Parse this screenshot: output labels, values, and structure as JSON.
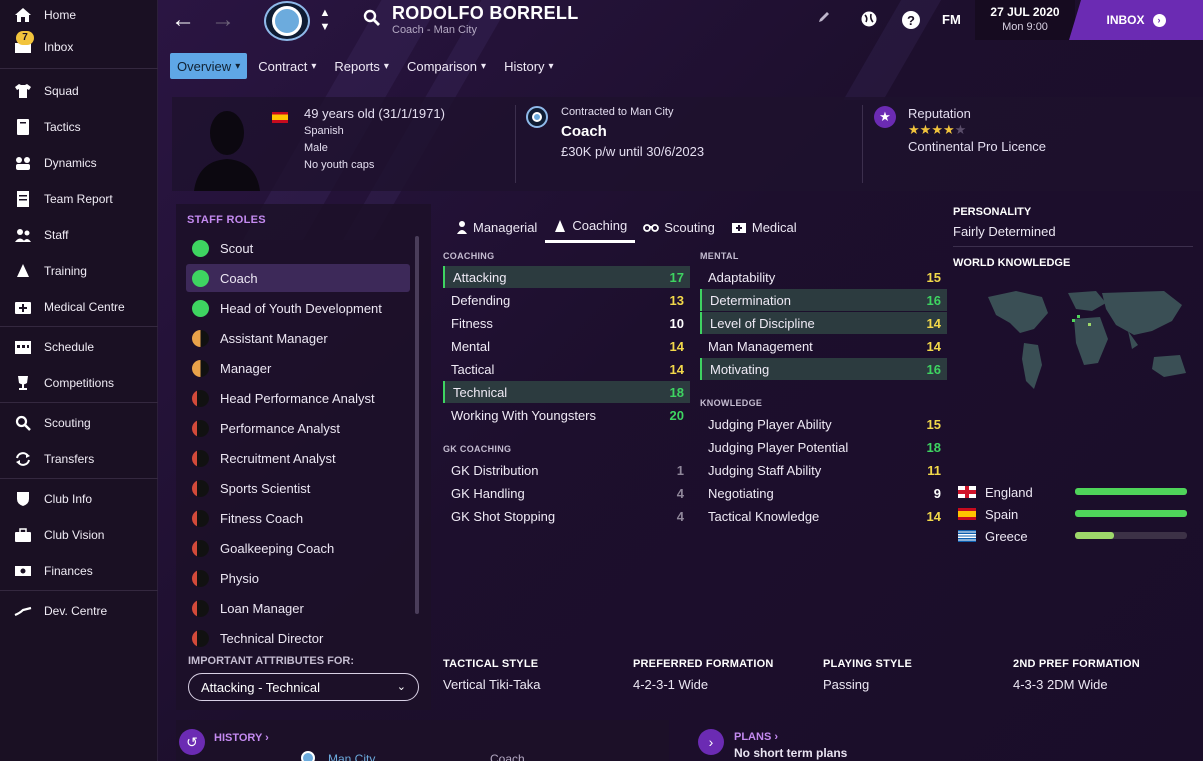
{
  "sidebar": {
    "items": [
      {
        "label": "Home",
        "icon": "home-icon"
      },
      {
        "label": "Inbox",
        "icon": "inbox-icon",
        "badge": "7"
      },
      {
        "label": "Squad",
        "icon": "shirt-icon"
      },
      {
        "label": "Tactics",
        "icon": "tactics-board-icon"
      },
      {
        "label": "Dynamics",
        "icon": "dynamics-icon"
      },
      {
        "label": "Team Report",
        "icon": "report-icon"
      },
      {
        "label": "Staff",
        "icon": "staff-icon"
      },
      {
        "label": "Training",
        "icon": "cone-icon"
      },
      {
        "label": "Medical Centre",
        "icon": "medical-kit-icon"
      },
      {
        "label": "Schedule",
        "icon": "calendar-icon"
      },
      {
        "label": "Competitions",
        "icon": "trophy-icon"
      },
      {
        "label": "Scouting",
        "icon": "search-icon"
      },
      {
        "label": "Transfers",
        "icon": "transfer-arrows-icon"
      },
      {
        "label": "Club Info",
        "icon": "shield-icon"
      },
      {
        "label": "Club Vision",
        "icon": "briefcase-icon"
      },
      {
        "label": "Finances",
        "icon": "money-icon"
      },
      {
        "label": "Dev. Centre",
        "icon": "dev-centre-icon"
      }
    ]
  },
  "topbar": {
    "name": "RODOLFO BORRELL",
    "subtitle": "Coach - Man City",
    "fm": "FM",
    "date": "27 JUL 2020",
    "time": "Mon 9:00",
    "inbox": "INBOX"
  },
  "tabs": [
    {
      "label": "Overview",
      "active": true
    },
    {
      "label": "Contract",
      "active": false
    },
    {
      "label": "Reports",
      "active": false
    },
    {
      "label": "Comparison",
      "active": false
    },
    {
      "label": "History",
      "active": false
    }
  ],
  "header": {
    "age": "49 years old (31/1/1971)",
    "nationality": "Spanish",
    "gender": "Male",
    "caps": "No youth caps",
    "contract_label": "Contracted to Man City",
    "role": "Coach",
    "wage": "£30K p/w until 30/6/2023",
    "reputation_label": "Reputation",
    "reputation_stars": 4,
    "reputation_max": 5,
    "licence": "Continental Pro Licence"
  },
  "staff_roles": {
    "title": "STAFF ROLES",
    "roles": [
      {
        "label": "Scout",
        "suitability": "full"
      },
      {
        "label": "Coach",
        "suitability": "full",
        "selected": true
      },
      {
        "label": "Head of Youth Development",
        "suitability": "full"
      },
      {
        "label": "Assistant Manager",
        "suitability": "half"
      },
      {
        "label": "Manager",
        "suitability": "half"
      },
      {
        "label": "Head Performance Analyst",
        "suitability": "min"
      },
      {
        "label": "Performance Analyst",
        "suitability": "min"
      },
      {
        "label": "Recruitment Analyst",
        "suitability": "min"
      },
      {
        "label": "Sports Scientist",
        "suitability": "min"
      },
      {
        "label": "Fitness Coach",
        "suitability": "min"
      },
      {
        "label": "Goalkeeping Coach",
        "suitability": "min"
      },
      {
        "label": "Physio",
        "suitability": "min"
      },
      {
        "label": "Loan Manager",
        "suitability": "min"
      },
      {
        "label": "Technical Director",
        "suitability": "min"
      }
    ],
    "important_label": "IMPORTANT ATTRIBUTES FOR:",
    "important_value": "Attacking - Technical"
  },
  "attr_tabs": [
    {
      "label": "Managerial",
      "icon": "managerial-icon",
      "active": false
    },
    {
      "label": "Coaching",
      "icon": "cone-icon",
      "active": true
    },
    {
      "label": "Scouting",
      "icon": "binoculars-icon",
      "active": false
    },
    {
      "label": "Medical",
      "icon": "medical-kit-icon",
      "active": false
    }
  ],
  "coaching": {
    "title": "COACHING",
    "rows": [
      {
        "name": "Attacking",
        "value": "17",
        "hl": true
      },
      {
        "name": "Defending",
        "value": "13",
        "hl": false
      },
      {
        "name": "Fitness",
        "value": "10",
        "hl": false
      },
      {
        "name": "Mental",
        "value": "14",
        "hl": false
      },
      {
        "name": "Tactical",
        "value": "14",
        "hl": false
      },
      {
        "name": "Technical",
        "value": "18",
        "hl": true
      },
      {
        "name": "Working With Youngsters",
        "value": "20",
        "hl": false
      }
    ]
  },
  "gk_coaching": {
    "title": "GK COACHING",
    "rows": [
      {
        "name": "GK Distribution",
        "value": "1"
      },
      {
        "name": "GK Handling",
        "value": "4"
      },
      {
        "name": "GK Shot Stopping",
        "value": "4"
      }
    ]
  },
  "mental": {
    "title": "MENTAL",
    "rows": [
      {
        "name": "Adaptability",
        "value": "15",
        "hl": false
      },
      {
        "name": "Determination",
        "value": "16",
        "hl": true
      },
      {
        "name": "Level of Discipline",
        "value": "14",
        "hl": true
      },
      {
        "name": "Man Management",
        "value": "14",
        "hl": false
      },
      {
        "name": "Motivating",
        "value": "16",
        "hl": true
      }
    ]
  },
  "knowledge": {
    "title": "KNOWLEDGE",
    "rows": [
      {
        "name": "Judging Player Ability",
        "value": "15"
      },
      {
        "name": "Judging Player Potential",
        "value": "18"
      },
      {
        "name": "Judging Staff Ability",
        "value": "11"
      },
      {
        "name": "Negotiating",
        "value": "9"
      },
      {
        "name": "Tactical Knowledge",
        "value": "14"
      }
    ]
  },
  "personality": {
    "title": "PERSONALITY",
    "value": "Fairly Determined"
  },
  "world_knowledge": {
    "title": "WORLD KNOWLEDGE",
    "languages": [
      {
        "name": "England",
        "flag": "england",
        "level": 1.0
      },
      {
        "name": "Spain",
        "flag": "spain",
        "level": 1.0
      },
      {
        "name": "Greece",
        "flag": "greece",
        "level": 0.35
      }
    ]
  },
  "style": {
    "tactical_style_title": "TACTICAL STYLE",
    "tactical_style": "Vertical Tiki-Taka",
    "pref_formation_title": "PREFERRED FORMATION",
    "pref_formation": "4-2-3-1 Wide",
    "playing_style_title": "PLAYING STYLE",
    "playing_style": "Passing",
    "second_formation_title": "2ND PREF FORMATION",
    "second_formation": "4-3-3 2DM Wide"
  },
  "bottom": {
    "history_title": "HISTORY",
    "history_partial": "Man City",
    "history_role_partial": "Coach",
    "plans_title": "PLANS",
    "plans_text": "No short term plans"
  },
  "colors": {
    "accent": "#6b2bb3",
    "tab_active": "#5fa7e6",
    "green": "#3ed461",
    "yellow": "#f2d84a",
    "panel_title": "#c48af0"
  }
}
